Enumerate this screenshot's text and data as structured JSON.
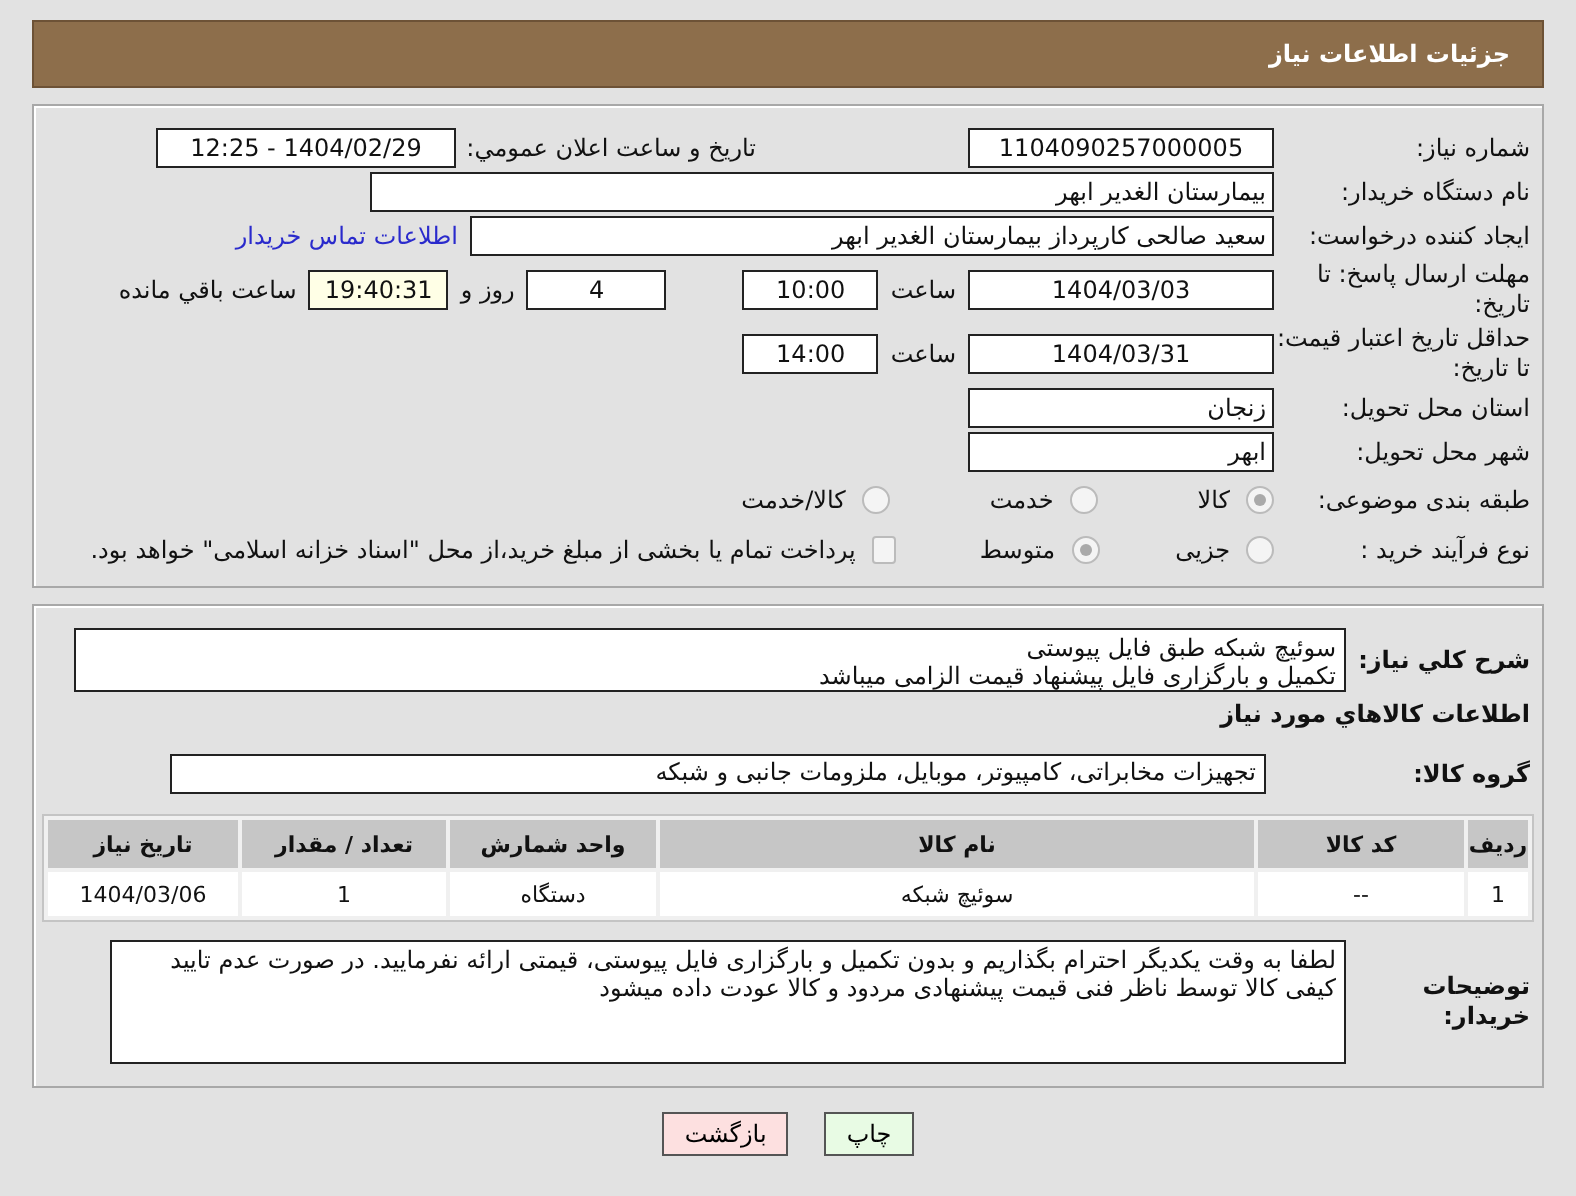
{
  "header": {
    "title": "جزئیات اطلاعات نیاز"
  },
  "need_number": {
    "label": "شماره نیاز:",
    "value": "1104090257000005"
  },
  "announce": {
    "label": "تاریخ و ساعت اعلان عمومي:",
    "value": "1404/02/29 - 12:25"
  },
  "buyer_org": {
    "label": "نام دستگاه خریدار:",
    "value": "بیمارستان الغدیر ابهر"
  },
  "requester": {
    "label": "ایجاد کننده درخواست:",
    "value": "سعید صالحی کارپرداز بیمارستان الغدیر ابهر",
    "contact_link": "اطلاعات تماس خریدار"
  },
  "reply_deadline": {
    "label": "مهلت ارسال پاسخ: تا تاریخ:",
    "date": "1404/03/03",
    "time_label": "ساعت",
    "time": "10:00",
    "days": "4",
    "days_label": "روز و",
    "remaining": "19:40:31",
    "remaining_label": "ساعت باقي مانده"
  },
  "price_validity": {
    "label": "حداقل تاریخ اعتبار قیمت: تا تاریخ:",
    "date": "1404/03/31",
    "time_label": "ساعت",
    "time": "14:00"
  },
  "province": {
    "label": "استان محل تحویل:",
    "value": "زنجان"
  },
  "city": {
    "label": "شهر محل تحویل:",
    "value": "ابهر"
  },
  "category": {
    "label": "طبقه بندی موضوعی:",
    "options": [
      {
        "label": "کالا",
        "selected": true
      },
      {
        "label": "خدمت",
        "selected": false
      },
      {
        "label": "کالا/خدمت",
        "selected": false
      }
    ]
  },
  "process": {
    "label": "نوع فرآیند خرید :",
    "options": [
      {
        "label": "جزیی",
        "selected": false
      },
      {
        "label": "متوسط",
        "selected": true
      }
    ],
    "payment": {
      "checked": false,
      "text": "پرداخت تمام یا بخشی از مبلغ خرید،از محل \"اسناد خزانه اسلامی\" خواهد بود."
    }
  },
  "summary": {
    "label": "شرح کلي نیاز:",
    "lines": [
      "سوئیچ شبکه طبق فایل پیوستی",
      "تکمیل و بارگزاری فایل پیشنهاد قیمت الزامی میباشد"
    ]
  },
  "goods_title": "اطلاعات کالاهاي مورد نیاز",
  "goods_group": {
    "label": "گروه کالا:",
    "value": "تجهیزات مخابراتی، کامپیوتر، موبایل، ملزومات جانبی و شبکه"
  },
  "table": {
    "columns": [
      "ردیف",
      "کد کالا",
      "نام کالا",
      "واحد شمارش",
      "تعداد / مقدار",
      "تاریخ نیاز"
    ],
    "rows": [
      [
        "1",
        "--",
        "سوئیچ شبکه",
        "دستگاه",
        "1",
        "1404/03/06"
      ]
    ]
  },
  "buyer_notes": {
    "label": "توضیحات خریدار:",
    "value": "لطفا به وقت یکدیگر احترام بگذاریم و بدون تکمیل و بارگزاری فایل پیوستی، قیمتی ارائه نفرمایید. در صورت عدم تایید کیفی کالا توسط ناظر فنی قیمت پیشنهادی مردود و کالا عودت داده میشود"
  },
  "buttons": [
    {
      "label": "چاپ",
      "kind": "print"
    },
    {
      "label": "بازگشت",
      "kind": "back"
    }
  ]
}
